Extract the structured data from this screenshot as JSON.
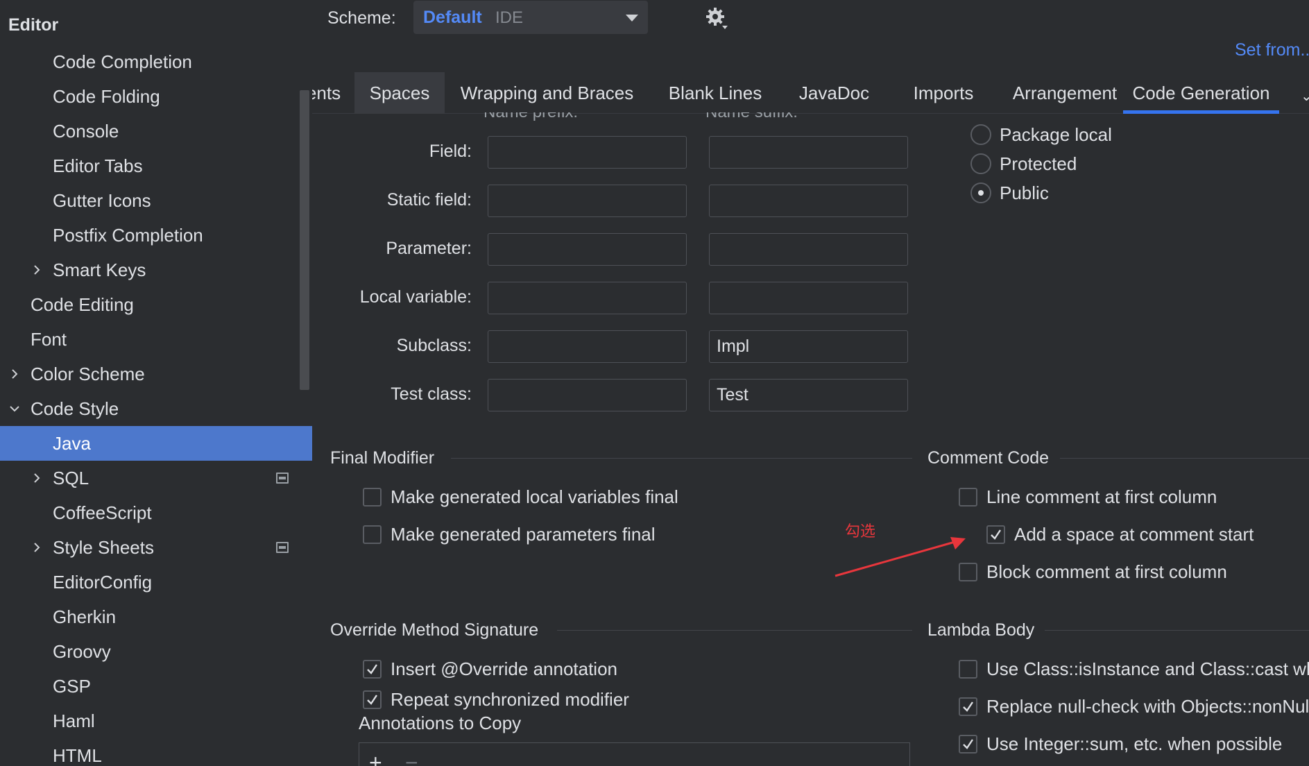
{
  "sidebar": {
    "section_title": "Editor",
    "items": [
      {
        "label": "Code Completion"
      },
      {
        "label": "Code Folding"
      },
      {
        "label": "Console"
      },
      {
        "label": "Editor Tabs"
      },
      {
        "label": "Gutter Icons"
      },
      {
        "label": "Postfix Completion"
      },
      {
        "label": "Smart Keys",
        "chevron": "chevron-right-icon"
      },
      {
        "label": "Code Editing"
      },
      {
        "label": "Font"
      },
      {
        "label": "Color Scheme",
        "chevron": "chevron-right-icon"
      },
      {
        "label": "Code Style",
        "chevron": "chevron-down-icon",
        "expanded": true
      },
      {
        "label": "Java",
        "selected": true
      },
      {
        "label": "SQL",
        "chevron": "chevron-right-icon",
        "icon": "project-settings-icon"
      },
      {
        "label": "CoffeeScript"
      },
      {
        "label": "Style Sheets",
        "chevron": "chevron-right-icon",
        "icon": "project-settings-icon"
      },
      {
        "label": "EditorConfig"
      },
      {
        "label": "Gherkin"
      },
      {
        "label": "Groovy"
      },
      {
        "label": "GSP"
      },
      {
        "label": "Haml"
      },
      {
        "label": "HTML"
      }
    ]
  },
  "header": {
    "scheme_label": "Scheme:",
    "scheme_name": "Default",
    "scheme_kind": "IDE",
    "gear_icon": "gear-icon",
    "set_from": "Set from..."
  },
  "tabs": [
    {
      "label": "ents"
    },
    {
      "label": "Spaces",
      "hover": true
    },
    {
      "label": "Wrapping and Braces"
    },
    {
      "label": "Blank Lines"
    },
    {
      "label": "JavaDoc"
    },
    {
      "label": "Imports"
    },
    {
      "label": "Arrangement"
    },
    {
      "label": "Code Generation",
      "active": true
    }
  ],
  "naming": {
    "col_prefix_header": "Name prefix:",
    "col_suffix_header": "Name suffix:",
    "rows": [
      {
        "label": "Field:",
        "prefix": "",
        "suffix": ""
      },
      {
        "label": "Static field:",
        "prefix": "",
        "suffix": ""
      },
      {
        "label": "Parameter:",
        "prefix": "",
        "suffix": ""
      },
      {
        "label": "Local variable:",
        "prefix": "",
        "suffix": ""
      },
      {
        "label": "Subclass:",
        "prefix": "",
        "suffix": "Impl"
      },
      {
        "label": "Test class:",
        "prefix": "",
        "suffix": "Test"
      }
    ]
  },
  "visibility": {
    "options": [
      {
        "label": "Package local",
        "selected": false
      },
      {
        "label": "Protected",
        "selected": false
      },
      {
        "label": "Public",
        "selected": true
      }
    ]
  },
  "final_modifier": {
    "title": "Final Modifier",
    "options": [
      {
        "label": "Make generated local variables final",
        "checked": false
      },
      {
        "label": "Make generated parameters final",
        "checked": false
      }
    ]
  },
  "comment_code": {
    "title": "Comment Code",
    "options": [
      {
        "label": "Line comment at first column",
        "checked": false
      },
      {
        "label": "Add a space at comment start",
        "checked": true
      },
      {
        "label": "Block comment at first column",
        "checked": false
      }
    ]
  },
  "override_method": {
    "title": "Override Method Signature",
    "options": [
      {
        "label": "Insert @Override annotation",
        "checked": true
      },
      {
        "label": "Repeat synchronized modifier",
        "checked": true
      }
    ],
    "annotations_label": "Annotations to Copy",
    "add_label": "+",
    "remove_label": "−"
  },
  "lambda_body": {
    "title": "Lambda Body",
    "options": [
      {
        "label": "Use Class::isInstance and Class::cast when possible",
        "checked": false
      },
      {
        "label": "Replace null-check with Objects::nonNull or Objects::isNull",
        "checked": true
      },
      {
        "label": "Use Integer::sum, etc. when possible",
        "checked": true
      }
    ]
  },
  "annotation_overlay": {
    "note": "勾选",
    "color": "#e8363c"
  },
  "colors": {
    "accent": "#3574f0",
    "selection": "#4d78cc",
    "link": "#548af7"
  }
}
